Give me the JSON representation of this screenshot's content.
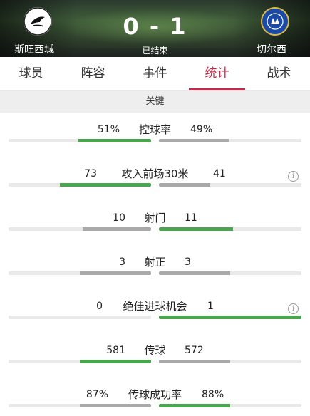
{
  "match": {
    "home_team": "斯旺西城",
    "away_team": "切尔西",
    "score": "0 - 1",
    "status": "已结束"
  },
  "tabs": [
    {
      "label": "球员",
      "active": false
    },
    {
      "label": "阵容",
      "active": false
    },
    {
      "label": "事件",
      "active": false
    },
    {
      "label": "统计",
      "active": true
    },
    {
      "label": "战术",
      "active": false
    }
  ],
  "section": {
    "title": "关键"
  },
  "stats": [
    {
      "label": "控球率",
      "home": "51%",
      "away": "49%",
      "home_frac": 0.51,
      "away_frac": 0.49,
      "leader": "home",
      "info": false
    },
    {
      "label": "攻入前场30米",
      "home": "73",
      "away": "41",
      "home_frac": 0.64,
      "away_frac": 0.36,
      "leader": "home",
      "info": true
    },
    {
      "label": "射门",
      "home": "10",
      "away": "11",
      "home_frac": 0.48,
      "away_frac": 0.52,
      "leader": "away",
      "info": false
    },
    {
      "label": "射正",
      "home": "3",
      "away": "3",
      "home_frac": 0.5,
      "away_frac": 0.5,
      "leader": "none",
      "info": false
    },
    {
      "label": "绝佳进球机会",
      "home": "0",
      "away": "1",
      "home_frac": 0.0,
      "away_frac": 1.0,
      "leader": "away",
      "info": true
    },
    {
      "label": "传球",
      "home": "581",
      "away": "572",
      "home_frac": 0.5,
      "away_frac": 0.5,
      "leader": "home",
      "info": false
    },
    {
      "label": "传球成功率",
      "home": "87%",
      "away": "88%",
      "home_frac": 0.5,
      "away_frac": 0.5,
      "leader": "away",
      "info": false
    }
  ],
  "icons": {
    "info": "info-icon",
    "info_glyph": "i"
  },
  "colors": {
    "accent": "#c62a4a",
    "leader_bar": "#4aa54e",
    "other_bar": "#a9a9a9"
  }
}
